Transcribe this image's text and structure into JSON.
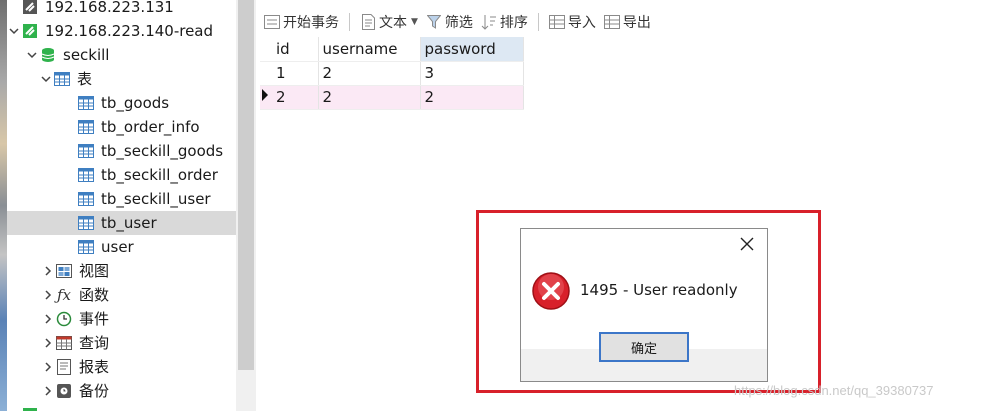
{
  "colors": {
    "selected_row": "#d9d9d9",
    "db_green": "#2fb24c",
    "table_blue": "#3f7fc1",
    "error_red": "#d8202a",
    "highlight_header": "#dde8f3",
    "current_row": "#fbe9f5"
  },
  "tree": {
    "items": [
      {
        "label": "192.168.223.131",
        "icon": "connection-icon"
      },
      {
        "label": "192.168.223.140-read",
        "icon": "connection-icon"
      },
      {
        "label": "seckill",
        "icon": "database-icon"
      },
      {
        "label": "表",
        "icon": "tables-icon"
      },
      {
        "label": "tb_goods",
        "icon": "table-icon"
      },
      {
        "label": "tb_order_info",
        "icon": "table-icon"
      },
      {
        "label": "tb_seckill_goods",
        "icon": "table-icon"
      },
      {
        "label": "tb_seckill_order",
        "icon": "table-icon"
      },
      {
        "label": "tb_seckill_user",
        "icon": "table-icon"
      },
      {
        "label": "tb_user",
        "icon": "table-icon"
      },
      {
        "label": "user",
        "icon": "table-icon"
      },
      {
        "label": "视图",
        "icon": "view-icon"
      },
      {
        "label": "函数",
        "icon": "function-icon"
      },
      {
        "label": "事件",
        "icon": "event-icon"
      },
      {
        "label": "查询",
        "icon": "query-icon"
      },
      {
        "label": "报表",
        "icon": "report-icon"
      },
      {
        "label": "备份",
        "icon": "backup-icon"
      }
    ]
  },
  "toolbar": {
    "begin_transaction": "开始事务",
    "text": "文本",
    "filter": "筛选",
    "sort": "排序",
    "import": "导入",
    "export": "导出"
  },
  "grid": {
    "columns": [
      "id",
      "username",
      "password"
    ],
    "rows": [
      [
        "1",
        "2",
        "3"
      ],
      [
        "2",
        "2",
        "2"
      ]
    ]
  },
  "dialog": {
    "message": "1495 - User readonly",
    "ok_label": "确定"
  },
  "watermark": "https://blog.csdn.net/qq_39380737"
}
